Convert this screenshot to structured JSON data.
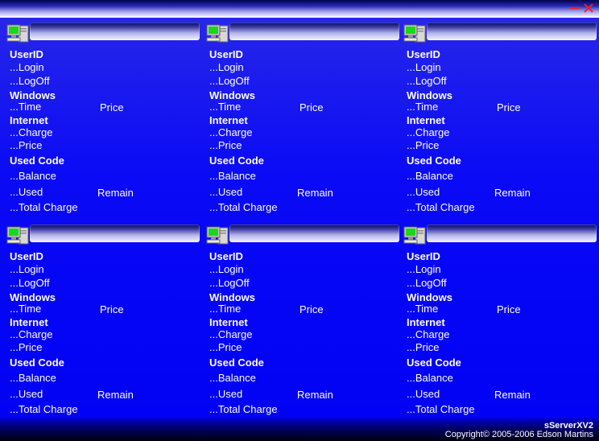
{
  "window": {
    "titlebar_buttons": {
      "minimize": "minimize-icon",
      "close": "close-icon"
    },
    "accent_color": "#0000f4",
    "button_color": "#ff1a1a"
  },
  "panels": [
    {
      "station": {
        "name": "",
        "icon": "computer-icon"
      },
      "labels": {
        "userid": "UserID",
        "login": "...Login",
        "logoff": "...LogOff",
        "windows": "Windows",
        "time": "...Time",
        "price": "Price",
        "internet": "Internet",
        "charge": "...Charge",
        "internet_price": "...Price",
        "used_code": "Used Code",
        "balance": "...Balance",
        "used": "...Used",
        "remain": "Remain",
        "total_charge": "...Total Charge"
      }
    },
    {
      "station": {
        "name": "",
        "icon": "computer-icon"
      },
      "labels": {
        "userid": "UserID",
        "login": "...Login",
        "logoff": "...LogOff",
        "windows": "Windows",
        "time": "...Time",
        "price": "Price",
        "internet": "Internet",
        "charge": "...Charge",
        "internet_price": "...Price",
        "used_code": "Used Code",
        "balance": "...Balance",
        "used": "...Used",
        "remain": "Remain",
        "total_charge": "...Total Charge"
      }
    },
    {
      "station": {
        "name": "",
        "icon": "computer-icon"
      },
      "labels": {
        "userid": "UserID",
        "login": "...Login",
        "logoff": "...LogOff",
        "windows": "Windows",
        "time": "...Time",
        "price": "Price",
        "internet": "Internet",
        "charge": "...Charge",
        "internet_price": "...Price",
        "used_code": "Used Code",
        "balance": "...Balance",
        "used": "...Used",
        "remain": "Remain",
        "total_charge": "...Total Charge"
      }
    },
    {
      "station": {
        "name": "",
        "icon": "computer-icon"
      },
      "labels": {
        "userid": "UserID",
        "login": "...Login",
        "logoff": "...LogOff",
        "windows": "Windows",
        "time": "...Time",
        "price": "Price",
        "internet": "Internet",
        "charge": "...Charge",
        "internet_price": "...Price",
        "used_code": "Used Code",
        "balance": "...Balance",
        "used": "...Used",
        "remain": "Remain",
        "total_charge": "...Total Charge"
      }
    },
    {
      "station": {
        "name": "",
        "icon": "computer-icon"
      },
      "labels": {
        "userid": "UserID",
        "login": "...Login",
        "logoff": "...LogOff",
        "windows": "Windows",
        "time": "...Time",
        "price": "Price",
        "internet": "Internet",
        "charge": "...Charge",
        "internet_price": "...Price",
        "used_code": "Used Code",
        "balance": "...Balance",
        "used": "...Used",
        "remain": "Remain",
        "total_charge": "...Total Charge"
      }
    },
    {
      "station": {
        "name": "",
        "icon": "computer-icon"
      },
      "labels": {
        "userid": "UserID",
        "login": "...Login",
        "logoff": "...LogOff",
        "windows": "Windows",
        "time": "...Time",
        "price": "Price",
        "internet": "Internet",
        "charge": "...Charge",
        "internet_price": "...Price",
        "used_code": "Used Code",
        "balance": "...Balance",
        "used": "...Used",
        "remain": "Remain",
        "total_charge": "...Total Charge"
      }
    }
  ],
  "footer": {
    "app_name": "sServerXV2",
    "copyright": "Copyright© 2005-2006 Edson Martins"
  }
}
